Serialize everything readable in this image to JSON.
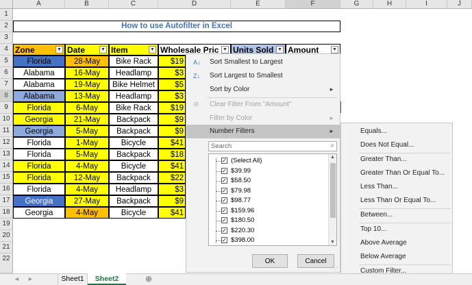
{
  "columns": [
    "A",
    "B",
    "C",
    "D",
    "E",
    "F",
    "G",
    "H",
    "I",
    "J"
  ],
  "rows": [
    "1",
    "2",
    "3",
    "4",
    "5",
    "6",
    "7",
    "8",
    "9",
    "10",
    "11",
    "12",
    "13",
    "14",
    "15",
    "16",
    "17",
    "18",
    "19",
    "20",
    "21",
    "22"
  ],
  "title": "How to use Autofilter in Excel",
  "headers": {
    "zone": "Zone",
    "date": "Date",
    "item": "Item",
    "wholesale": "Wholesale Pric",
    "units": "Units Sold",
    "amount": "Amount"
  },
  "data_rows": [
    {
      "zone": "Florida",
      "date": "28-May",
      "item": "Bike Rack",
      "price": "$19"
    },
    {
      "zone": "Alabama",
      "date": "16-May",
      "item": "Headlamp",
      "price": "$3"
    },
    {
      "zone": "Alabama",
      "date": "19-May",
      "item": "Bike Helmet",
      "price": "$5"
    },
    {
      "zone": "Alabama",
      "date": "13-May",
      "item": "Headlamp",
      "price": "$3"
    },
    {
      "zone": "Florida",
      "date": "6-May",
      "item": "Bike Rack",
      "price": "$19"
    },
    {
      "zone": "Georgia",
      "date": "21-May",
      "item": "Backpack",
      "price": "$9"
    },
    {
      "zone": "Georgia",
      "date": "5-May",
      "item": "Backpack",
      "price": "$9"
    },
    {
      "zone": "Florida",
      "date": "1-May",
      "item": "Bicycle",
      "price": "$41"
    },
    {
      "zone": "Florida",
      "date": "5-May",
      "item": "Backpack",
      "price": "$18"
    },
    {
      "zone": "Florida",
      "date": "4-May",
      "item": "Bicycle",
      "price": "$41"
    },
    {
      "zone": "Florida",
      "date": "12-May",
      "item": "Backpack",
      "price": "$22"
    },
    {
      "zone": "Florida",
      "date": "4-May",
      "item": "Headlamp",
      "price": "$3"
    },
    {
      "zone": "Georgia",
      "date": "27-May",
      "item": "Backpack",
      "price": "$9"
    },
    {
      "zone": "Georgia",
      "date": "4-May",
      "item": "Bicycle",
      "price": "$41"
    }
  ],
  "menu": {
    "sort_asc": "Sort Smallest to Largest",
    "sort_desc": "Sort Largest to Smallest",
    "sort_color": "Sort by Color",
    "clear_filter": "Clear Filter From \"Amount\"",
    "filter_color": "Filter by Color",
    "number_filters": "Number Filters",
    "search_placeholder": "Search",
    "values": [
      "(Select All)",
      "$39.99",
      "$58.50",
      "$79.98",
      "$98.77",
      "$159.96",
      "$180.50",
      "$220.30",
      "$398.00"
    ],
    "ok": "OK",
    "cancel": "Cancel"
  },
  "submenu": [
    "Equals...",
    "Does Not Equal...",
    "Greater Than...",
    "Greater Than Or Equal To...",
    "Less Than...",
    "Less Than Or Equal To...",
    "Between...",
    "Top 10...",
    "Above Average",
    "Below Average",
    "Custom Filter..."
  ],
  "tabs": {
    "sheet1": "Sheet1",
    "sheet2": "Sheet2",
    "add": "⊕"
  },
  "colors": {
    "orange": "#ffc000",
    "yellow": "#ffff00",
    "blue": "#4472c4",
    "lightblue": "#8ea9db",
    "green": "#217346",
    "menu_hover": "#c5c5c5"
  }
}
